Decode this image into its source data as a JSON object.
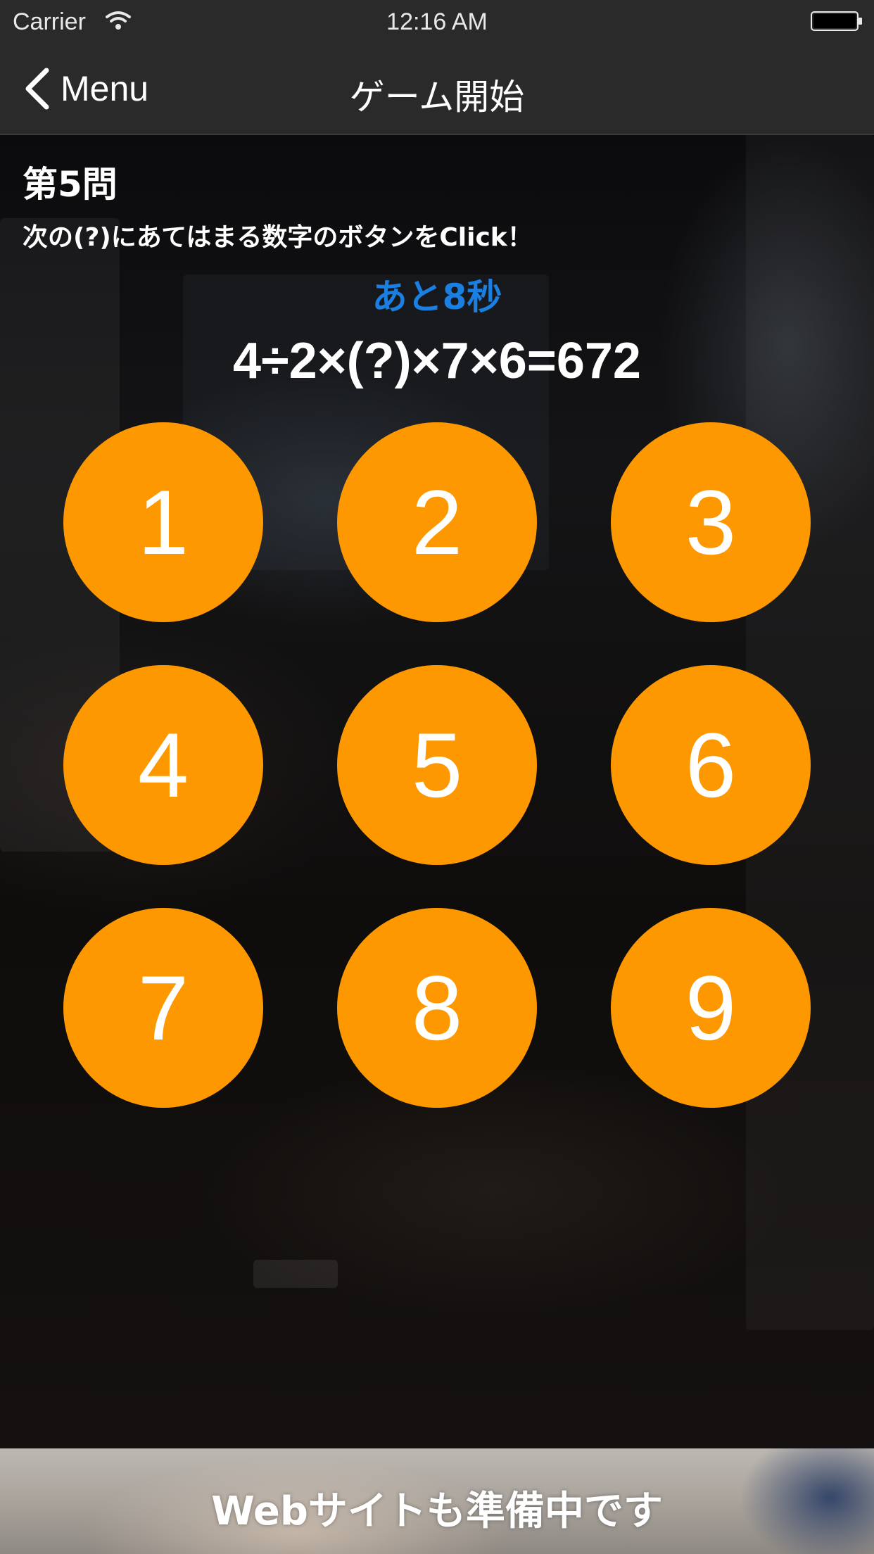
{
  "status_bar": {
    "carrier": "Carrier",
    "time": "12:16 AM"
  },
  "nav": {
    "back_label": "Menu",
    "title": "ゲーム開始"
  },
  "quiz": {
    "question_number": "第5問",
    "instruction": "次の(?)にあてはまる数字のボタンをClick！",
    "timer": "あと8秒",
    "equation": "4÷2×(?)×7×6=672"
  },
  "buttons": [
    "1",
    "2",
    "3",
    "4",
    "5",
    "6",
    "7",
    "8",
    "9"
  ],
  "colors": {
    "button": "#fe9800",
    "timer": "#1a7fe0",
    "bar": "#2a2a2a"
  },
  "footer": {
    "banner_text": "Webサイトも準備中です"
  }
}
